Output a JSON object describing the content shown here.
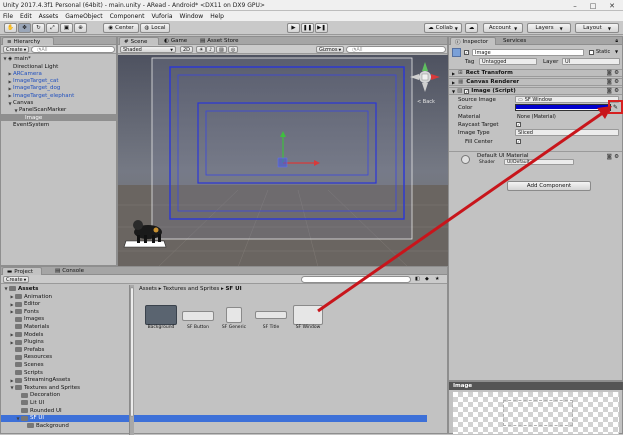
{
  "window": {
    "title": "Unity 2017.4.3f1 Personal (64bit) - main.unity - ARead - Android* <DX11 on DX9 GPU>",
    "min_glyph": "–",
    "max_glyph": "□",
    "close_glyph": "✕"
  },
  "menu": [
    "File",
    "Edit",
    "Assets",
    "GameObject",
    "Component",
    "Vuforia",
    "Window",
    "Help"
  ],
  "toolbar": {
    "center": "Center",
    "local": "Local",
    "collab": "Collab",
    "account": "Account",
    "layers": "Layers",
    "layout": "Layout"
  },
  "hierarchy": {
    "tab": "Hierarchy",
    "create": "Create",
    "search_placeholder": "◔All",
    "scene": "main*",
    "items": [
      {
        "label": "Directional Light",
        "level": 1,
        "expander": "",
        "color": "#111111"
      },
      {
        "label": "ARCamera",
        "level": 1,
        "expander": "▶",
        "color": "#1f4fbe"
      },
      {
        "label": "ImageTarget_cat",
        "level": 1,
        "expander": "▶",
        "color": "#1f4fbe"
      },
      {
        "label": "ImageTarget_dog",
        "level": 1,
        "expander": "▶",
        "color": "#1f4fbe"
      },
      {
        "label": "ImageTarget_elephant",
        "level": 1,
        "expander": "▶",
        "color": "#1f4fbe"
      },
      {
        "label": "Canvas",
        "level": 1,
        "expander": "▼",
        "color": "#111111"
      },
      {
        "label": "PanelScanMarker",
        "level": 2,
        "expander": "▼",
        "color": "#111111"
      },
      {
        "label": "Image",
        "level": 3,
        "expander": "",
        "color": "#ffffff",
        "selected": true
      },
      {
        "label": "EventSystem",
        "level": 1,
        "expander": "",
        "color": "#111111"
      }
    ]
  },
  "scene_view": {
    "tabs": {
      "scene": "Scene",
      "game": "Game",
      "asset_store": "Asset Store"
    },
    "shading": "Shaded",
    "mode_2d": "2D",
    "gizmos": "Gizmos",
    "search_placeholder": "◔All",
    "gizmo_label": "< Back"
  },
  "inspector": {
    "tabs": {
      "inspector": "Inspector",
      "services": "Services"
    },
    "object_name": "Image",
    "static_label": "Static",
    "tag_label": "Tag",
    "tag_value": "Untagged",
    "layer_label": "Layer",
    "layer_value": "UI",
    "components": {
      "rect_transform": "Rect Transform",
      "canvas_renderer": "Canvas Renderer",
      "image_script": "Image (Script)"
    },
    "source_image_label": "Source Image",
    "source_image_value": "SF Window",
    "color_label": "Color",
    "color_value": "#0000cc",
    "material_label": "Material",
    "material_value": "None (Material)",
    "raycast_label": "Raycast Target",
    "image_type_label": "Image Type",
    "image_type_value": "Sliced",
    "fill_center_label": "Fill Center",
    "default_material": "Default UI Material",
    "shader_label": "Shader",
    "shader_value": "UI/Default",
    "add_component": "Add Component"
  },
  "project": {
    "tabs": {
      "project": "Project",
      "console": "Console"
    },
    "create": "Create",
    "assets_root": "Assets",
    "tree": [
      {
        "label": "Animation",
        "level": 1,
        "expander": "▶"
      },
      {
        "label": "Editor",
        "level": 1,
        "expander": "▶"
      },
      {
        "label": "Fonts",
        "level": 1,
        "expander": "▶"
      },
      {
        "label": "Images",
        "level": 1,
        "expander": ""
      },
      {
        "label": "Materials",
        "level": 1,
        "expander": ""
      },
      {
        "label": "Models",
        "level": 1,
        "expander": "▶"
      },
      {
        "label": "Plugins",
        "level": 1,
        "expander": "▶"
      },
      {
        "label": "Prefabs",
        "level": 1,
        "expander": ""
      },
      {
        "label": "Resources",
        "level": 1,
        "expander": ""
      },
      {
        "label": "Scenes",
        "level": 1,
        "expander": ""
      },
      {
        "label": "Scripts",
        "level": 1,
        "expander": ""
      },
      {
        "label": "StreamingAssets",
        "level": 1,
        "expander": "▶"
      },
      {
        "label": "Textures and Sprites",
        "level": 1,
        "expander": "▼"
      },
      {
        "label": "Decoration",
        "level": 2,
        "expander": ""
      },
      {
        "label": "Lit UI",
        "level": 2,
        "expander": ""
      },
      {
        "label": "Rounded UI",
        "level": 2,
        "expander": ""
      },
      {
        "label": "SF UI",
        "level": 2,
        "expander": "▼",
        "selected": true
      },
      {
        "label": "Background",
        "level": 3,
        "expander": ""
      }
    ],
    "breadcrumb": [
      "Assets",
      "Textures and Sprites",
      "SF UI"
    ],
    "assets": [
      "Background",
      "SF Button",
      "SF Generic",
      "SF Title",
      "SF Window"
    ]
  },
  "preview": {
    "title": "Image"
  }
}
